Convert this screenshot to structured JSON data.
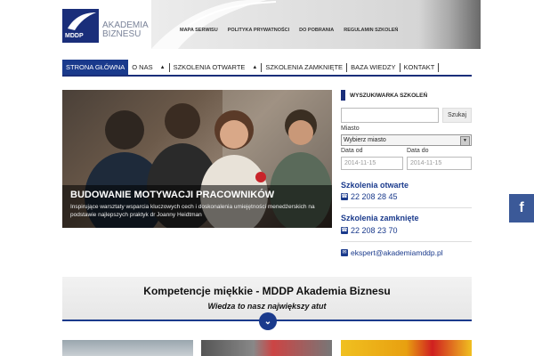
{
  "brand": {
    "logo_text": "MDDP",
    "name_line1": "AKADEMIA",
    "name_line2": "BIZNESU"
  },
  "top_links": [
    "MAPA SERWISU",
    "POLITYKA PRYWATNOŚCI",
    "DO POBRANIA",
    "REGULAMIN SZKOLEŃ"
  ],
  "nav": {
    "items": [
      {
        "label": "STRONA GŁÓWNA",
        "active": true,
        "dropdown": false
      },
      {
        "label": "O NAS",
        "active": false,
        "dropdown": true
      },
      {
        "label": "SZKOLENIA OTWARTE",
        "active": false,
        "dropdown": true
      },
      {
        "label": "SZKOLENIA ZAMKNIĘTE",
        "active": false,
        "dropdown": false
      },
      {
        "label": "BAZA WIEDZY",
        "active": false,
        "dropdown": false
      },
      {
        "label": "KONTAKT",
        "active": false,
        "dropdown": false
      }
    ]
  },
  "hero": {
    "title": "BUDOWANIE MOTYWACJI PRACOWNIKÓW",
    "text": "Inspirujące warsztaty wsparcia kluczowych cech i doskonalenia umiejętności menedżerskich na podstawie najlepszych praktyk dr Joanny Heidtman"
  },
  "search": {
    "heading": "WYSZUKIWARKA SZKOLEŃ",
    "input_value": "",
    "button_label": "Szukaj",
    "city_label": "Miasto",
    "city_selected": "Wybierz miasto",
    "date_from_label": "Data od",
    "date_from_value": "2014-11-15",
    "date_to_label": "Data do",
    "date_to_value": "2014-11-15"
  },
  "contacts": {
    "open_title": "Szkolenia otwarte",
    "open_phone": "22 208 28 45",
    "closed_title": "Szkolenia zamknięte",
    "closed_phone": "22 208 23 70",
    "email": "ekspert@akademiamddp.pl"
  },
  "social": {
    "facebook_label": "f"
  },
  "banner": {
    "title": "Kompetencje miękkie - MDDP Akademia Biznesu",
    "subtitle": "Wiedza to nasz największy atut"
  },
  "colors": {
    "brand_navy": "#1a2e7a",
    "link_blue": "#1a3a8c",
    "facebook": "#3b5998"
  }
}
